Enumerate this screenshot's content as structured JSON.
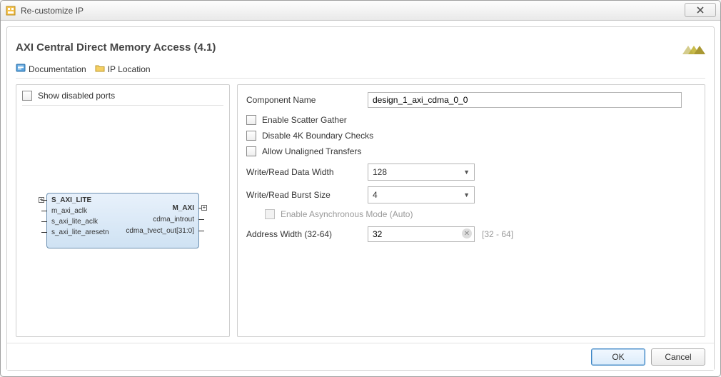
{
  "window": {
    "title": "Re-customize IP"
  },
  "ip": {
    "title": "AXI Central Direct Memory Access (4.1)"
  },
  "linkbar": {
    "doc": "Documentation",
    "iploc": "IP Location"
  },
  "left": {
    "show_disabled_ports": "Show disabled ports",
    "block": {
      "ports_left": [
        "S_AXI_LITE",
        "m_axi_aclk",
        "s_axi_lite_aclk",
        "s_axi_lite_aresetn"
      ],
      "ports_right": [
        "M_AXI",
        "cdma_introut",
        "cdma_tvect_out[31:0]"
      ]
    }
  },
  "form": {
    "component_name": {
      "label": "Component Name",
      "value": "design_1_axi_cdma_0_0"
    },
    "enable_sg": {
      "label": "Enable Scatter Gather"
    },
    "disable_4k": {
      "label": "Disable 4K Boundary Checks"
    },
    "allow_unaligned": {
      "label": "Allow Unaligned Transfers"
    },
    "data_width": {
      "label": "Write/Read Data Width",
      "value": "128"
    },
    "burst_size": {
      "label": "Write/Read Burst Size",
      "value": "4"
    },
    "async_mode": {
      "label": "Enable Asynchronous Mode (Auto)"
    },
    "addr_width": {
      "label": "Address Width (32-64)",
      "value": "32",
      "hint": "[32 - 64]"
    }
  },
  "footer": {
    "ok": "OK",
    "cancel": "Cancel"
  }
}
